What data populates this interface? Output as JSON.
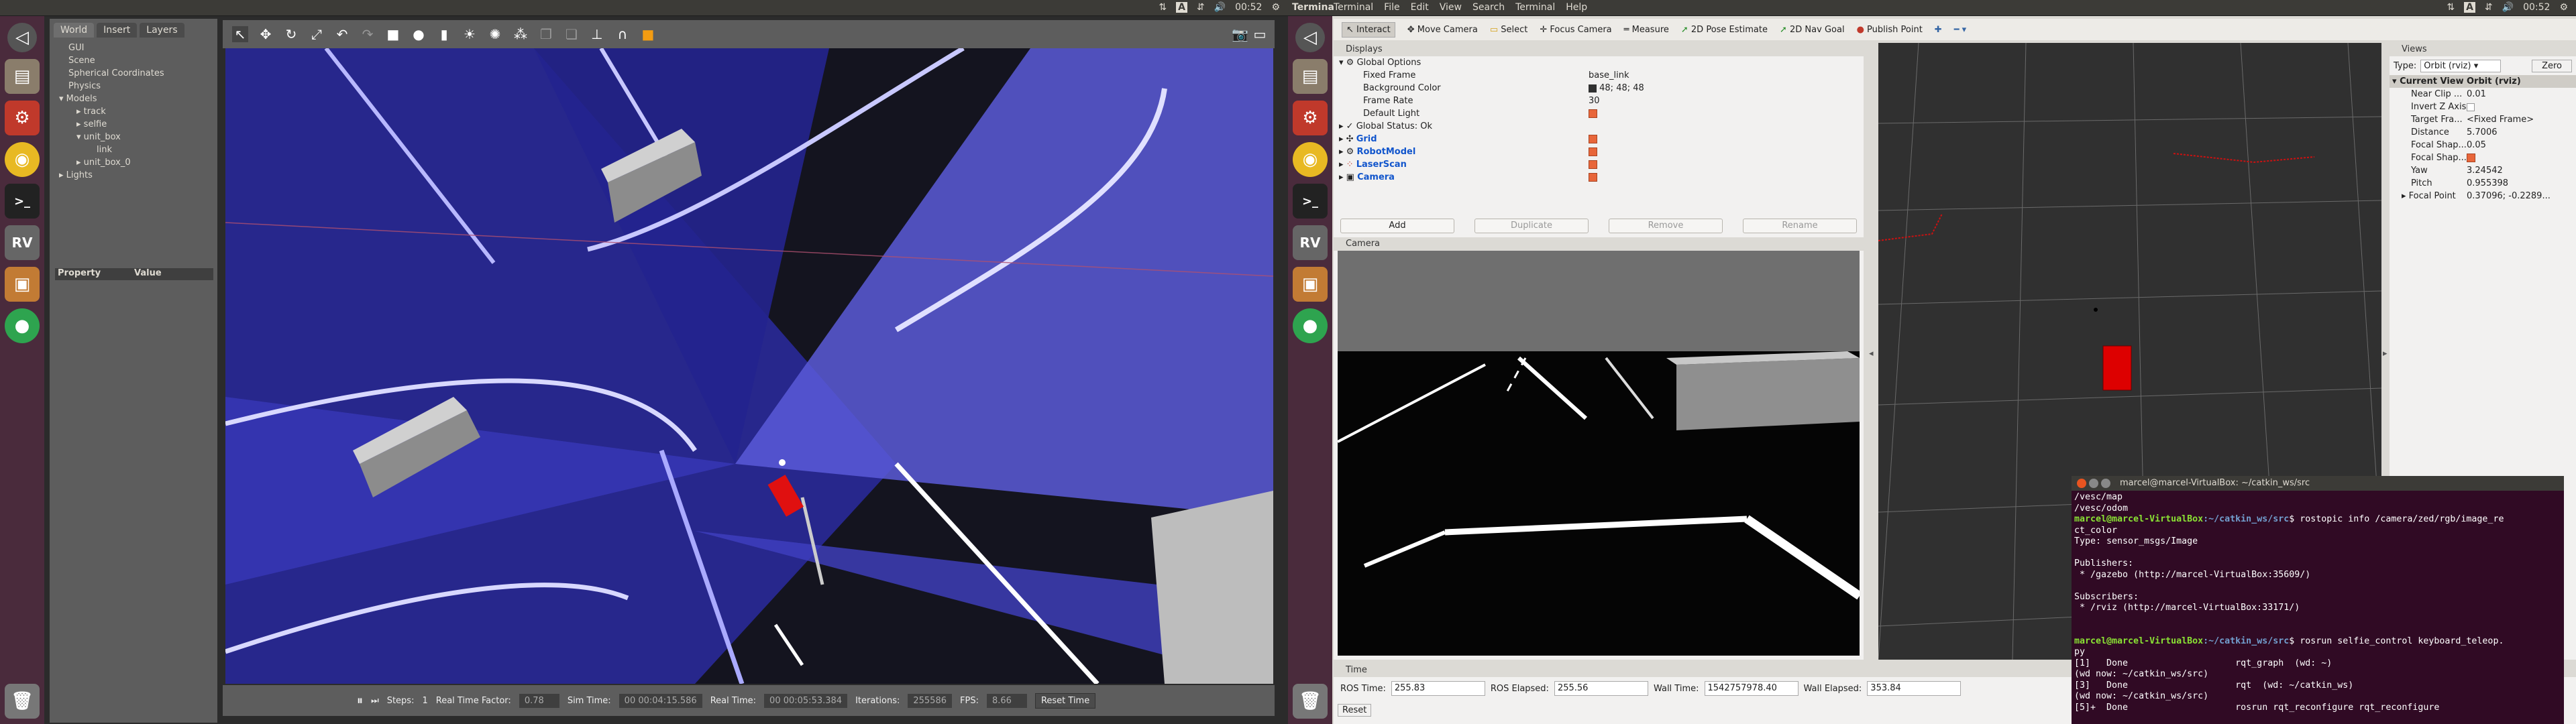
{
  "left_screen": {
    "topbar": {
      "time": "00:52",
      "lang": "A"
    },
    "gazebo": {
      "tabs": [
        "World",
        "Insert",
        "Layers"
      ],
      "tree": [
        "GUI",
        "Scene",
        "Spherical Coordinates",
        "Physics",
        "Models",
        "track",
        "selfie",
        "unit_box",
        "link",
        "unit_box_0",
        "Lights"
      ],
      "property_header": {
        "property": "Property",
        "value": "Value"
      },
      "bottom": {
        "steps_label": "Steps:",
        "steps_value": "1",
        "rtf_label": "Real Time Factor:",
        "rtf_value": "0.78",
        "sim_label": "Sim Time:",
        "sim_value": "00 00:04:15.586",
        "real_label": "Real Time:",
        "real_value": "00 00:05:53.384",
        "iter_label": "Iterations:",
        "iter_value": "255586",
        "fps_label": "FPS:",
        "fps_value": "8.66",
        "reset_label": "Reset Time"
      }
    }
  },
  "right_screen": {
    "topbar": {
      "app": "Termina",
      "menu": [
        "Terminal",
        "File",
        "Edit",
        "View",
        "Search",
        "Terminal",
        "Help"
      ],
      "time": "00:52",
      "lang": "A"
    },
    "rviz": {
      "tools": [
        "Interact",
        "Move Camera",
        "Select",
        "Focus Camera",
        "Measure",
        "2D Pose Estimate",
        "2D Nav Goal",
        "Publish Point"
      ],
      "displays_title": "Displays",
      "displays": [
        {
          "k": "Global Options",
          "v": ""
        },
        {
          "k": "Fixed Frame",
          "v": "base_link"
        },
        {
          "k": "Background Color",
          "v": "48; 48; 48"
        },
        {
          "k": "Frame Rate",
          "v": "30"
        },
        {
          "k": "Default Light",
          "v": ""
        },
        {
          "k": "Global Status: Ok",
          "v": ""
        },
        {
          "k": "Grid",
          "v": ""
        },
        {
          "k": "RobotModel",
          "v": ""
        },
        {
          "k": "LaserScan",
          "v": ""
        },
        {
          "k": "Camera",
          "v": ""
        }
      ],
      "buttons": [
        "Add",
        "Duplicate",
        "Remove",
        "Rename"
      ],
      "camera_title": "Camera",
      "views_title": "Views",
      "views_type_label": "Type:",
      "views_type_value": "Orbit (rviz)",
      "views_zero": "Zero",
      "current_view": {
        "k": "Current View",
        "v": "Orbit (rviz)"
      },
      "views": [
        {
          "k": "Near Clip ...",
          "v": "0.01"
        },
        {
          "k": "Invert Z Axis",
          "v": ""
        },
        {
          "k": "Target Fra...",
          "v": "<Fixed Frame>"
        },
        {
          "k": "Distance",
          "v": "5.7006"
        },
        {
          "k": "Focal Shap...",
          "v": "0.05"
        },
        {
          "k": "Focal Shap...",
          "v": ""
        },
        {
          "k": "Yaw",
          "v": "3.24542"
        },
        {
          "k": "Pitch",
          "v": "0.955398"
        },
        {
          "k": "Focal Point",
          "v": "0.37096; -0.2289..."
        }
      ],
      "time": {
        "title": "Time",
        "ros_time_label": "ROS Time:",
        "ros_time": "255.83",
        "ros_elapsed_label": "ROS Elapsed:",
        "ros_elapsed": "255.56",
        "wall_time_label": "Wall Time:",
        "wall_time": "1542757978.40",
        "wall_elapsed_label": "Wall Elapsed:",
        "wall_elapsed": "353.84",
        "reset": "Reset"
      }
    },
    "terminal": {
      "title": "marcel@marcel-VirtualBox: ~/catkin_ws/src",
      "lines": [
        {
          "t": "/vesc/map"
        },
        {
          "t": "/vesc/odom"
        },
        {
          "p": "marcel@marcel-VirtualBox",
          "d": ":~/catkin_ws/src",
          "c": "$ rostopic info /camera/zed/rgb/image_re"
        },
        {
          "t": "ct_color"
        },
        {
          "t": "Type: sensor_msgs/Image"
        },
        {
          "t": ""
        },
        {
          "t": "Publishers:"
        },
        {
          "t": " * /gazebo (http://marcel-VirtualBox:35609/)"
        },
        {
          "t": ""
        },
        {
          "t": "Subscribers:"
        },
        {
          "t": " * /rviz (http://marcel-VirtualBox:33171/)"
        },
        {
          "t": ""
        },
        {
          "t": ""
        },
        {
          "p": "marcel@marcel-VirtualBox",
          "d": ":~/catkin_ws/src",
          "c": "$ rosrun selfie_control keyboard_teleop."
        },
        {
          "t": "py"
        },
        {
          "t": "[1]   Done                    rqt_graph  (wd: ~)"
        },
        {
          "t": "(wd now: ~/catkin_ws/src)"
        },
        {
          "t": "[3]   Done                    rqt  (wd: ~/catkin_ws)"
        },
        {
          "t": "(wd now: ~/catkin_ws/src)"
        },
        {
          "t": "[5]+  Done                    rosrun rqt_reconfigure rqt_reconfigure"
        }
      ]
    }
  }
}
